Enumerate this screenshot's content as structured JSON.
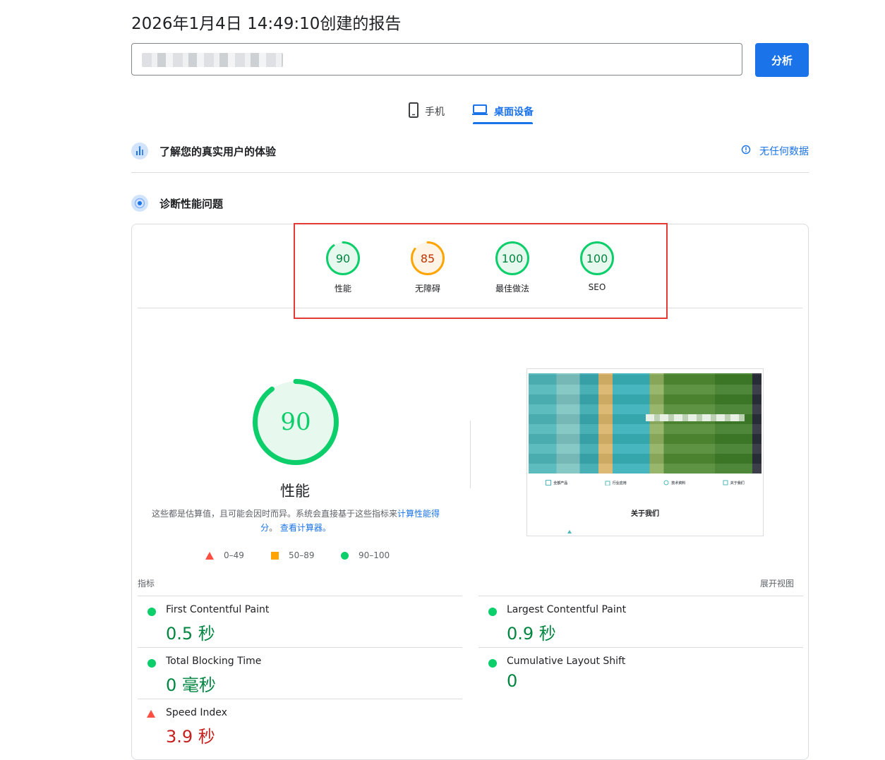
{
  "header": {
    "report_title": "2026年1月4日 14:49:10创建的报告",
    "url_value": "",
    "analyze_label": "分析"
  },
  "device_tabs": [
    {
      "label": "手机",
      "icon": "phone-icon",
      "selected": false
    },
    {
      "label": "桌面设备",
      "icon": "laptop-icon",
      "selected": true
    }
  ],
  "field_data": {
    "title": "了解您的真实用户的体验",
    "status": "无任何数据",
    "status_icon": "info-icon"
  },
  "diagnose": {
    "title": "诊断性能问题"
  },
  "category_scores": [
    {
      "label": "性能",
      "score": "90",
      "value": 90,
      "rating": "pass"
    },
    {
      "label": "无障碍",
      "score": "85",
      "value": 85,
      "rating": "average"
    },
    {
      "label": "最佳做法",
      "score": "100",
      "value": 100,
      "rating": "pass"
    },
    {
      "label": "SEO",
      "score": "100",
      "value": 100,
      "rating": "pass"
    }
  ],
  "performance": {
    "score": "90",
    "value": 90,
    "label": "性能",
    "desc_prefix": "这些都是估算值，且可能会因时而异。系统会直接基于这些指标来",
    "desc_link1": "计算性能得分",
    "desc_mid": "。",
    "desc_link2": "查看计算器。"
  },
  "legend": [
    {
      "range": "0–49",
      "shape": "triangle",
      "color": "#ff4e42"
    },
    {
      "range": "50–89",
      "shape": "square",
      "color": "#ffa400"
    },
    {
      "range": "90–100",
      "shape": "circle",
      "color": "#0cce6b"
    }
  ],
  "screenshot": {
    "caption": "关于我们",
    "nav_items": [
      "全部产品",
      "行业应用",
      "技术资料",
      "关于我们"
    ]
  },
  "metrics_header": {
    "left": "指标",
    "right": "展开视图"
  },
  "metrics": {
    "fcp": {
      "name": "First Contentful Paint",
      "value": "0.5 秒",
      "rating": "pass"
    },
    "lcp": {
      "name": "Largest Contentful Paint",
      "value": "0.9 秒",
      "rating": "pass"
    },
    "tbt": {
      "name": "Total Blocking Time",
      "value": "0 毫秒",
      "rating": "pass"
    },
    "cls": {
      "name": "Cumulative Layout Shift",
      "value": "0",
      "rating": "pass"
    },
    "si": {
      "name": "Speed Index",
      "value": "3.9 秒",
      "rating": "fail"
    }
  },
  "colors": {
    "accent": "#1a73e8",
    "pass": "#0cce6b",
    "pass_text": "#018642",
    "average": "#ffa400",
    "average_text": "#c33300",
    "fail": "#ff4e42",
    "fail_text": "#c5221f",
    "highlight_box": "#e53935"
  }
}
